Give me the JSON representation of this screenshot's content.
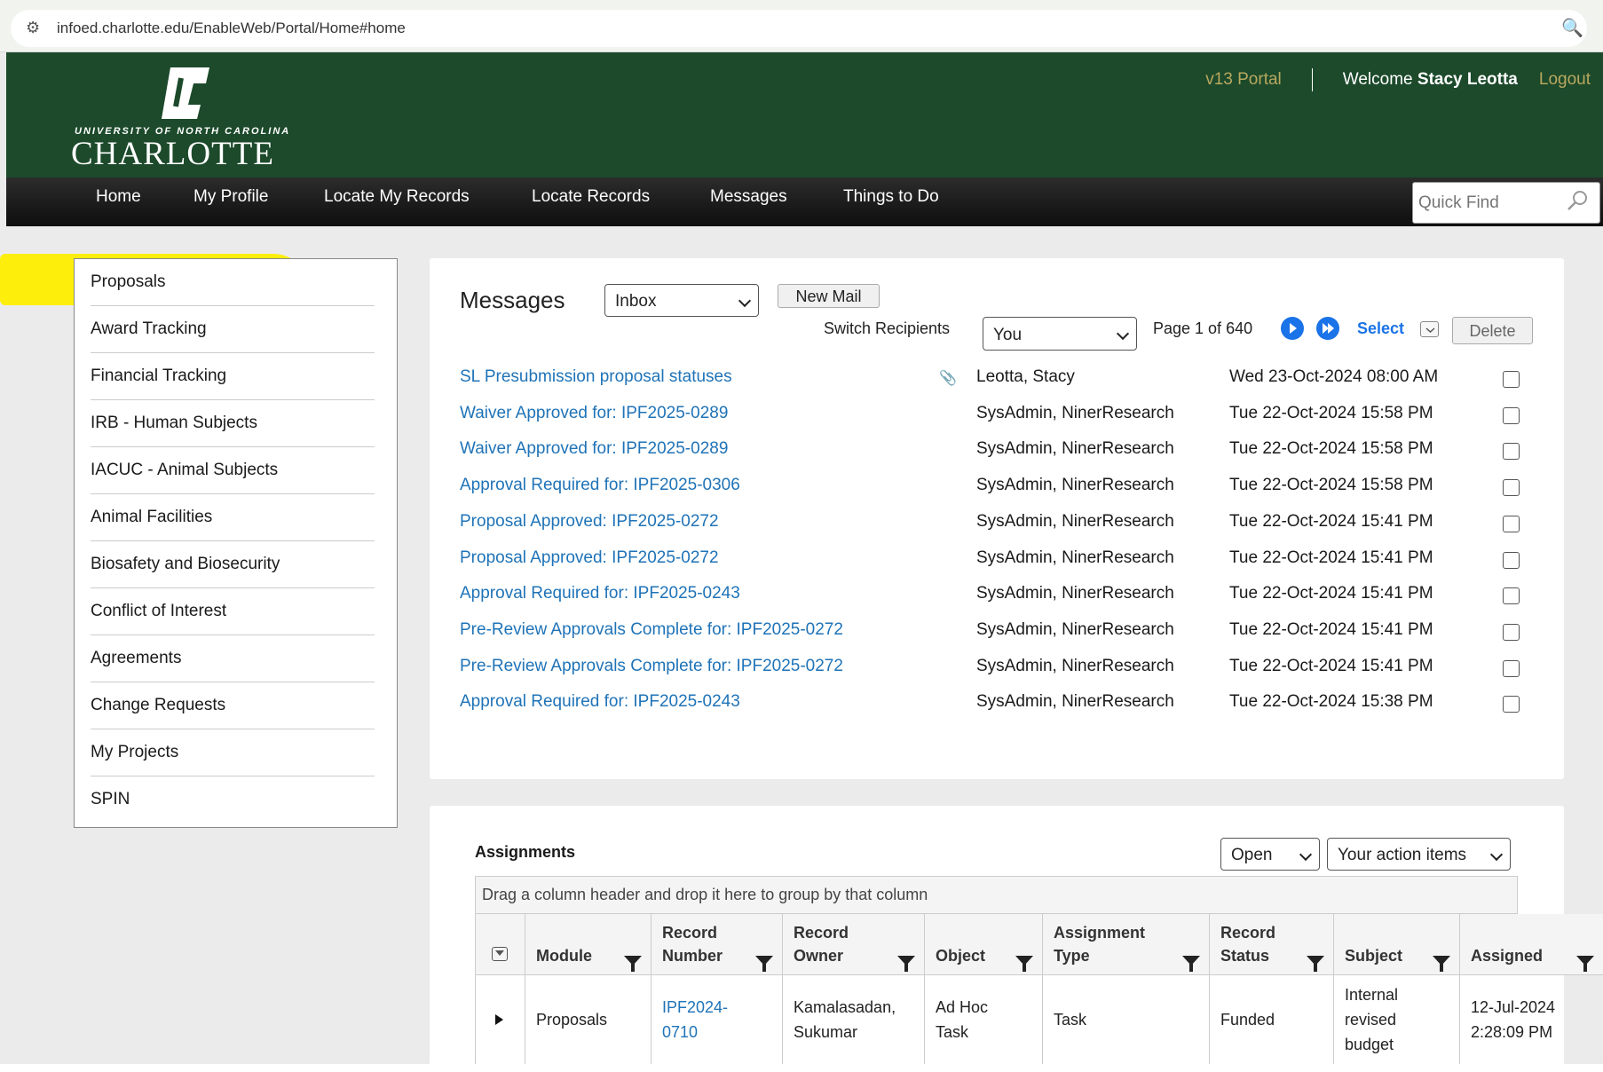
{
  "browser": {
    "url": "infoed.charlotte.edu/EnableWeb/Portal/Home#home"
  },
  "header": {
    "logo_univ": "UNIVERSITY OF NORTH CAROLINA",
    "logo_name": "CHARLOTTE",
    "portal_link": "v13 Portal",
    "welcome": "Welcome",
    "user_name": "Stacy Leotta",
    "logout": "Logout"
  },
  "nav": [
    "Home",
    "My Profile",
    "Locate My Records",
    "Locate Records",
    "Messages",
    "Things to Do"
  ],
  "quick_find": {
    "placeholder": "Quick Find"
  },
  "sidebar": [
    "Proposals",
    "Award Tracking",
    "Financial Tracking",
    "IRB - Human Subjects",
    "IACUC - Animal Subjects",
    "Animal Facilities",
    "Biosafety and Biosecurity",
    "Conflict of Interest",
    "Agreements",
    "Change Requests",
    "My Projects",
    "SPIN"
  ],
  "highlight_color": "#ffee00",
  "messages": {
    "title": "Messages",
    "folder": "Inbox",
    "new_mail": "New Mail",
    "switch_label": "Switch Recipients",
    "recipient": "You",
    "page_info": "Page 1 of 640",
    "select": "Select",
    "delete": "Delete",
    "rows": [
      {
        "subject": "SL Presubmission proposal statuses",
        "from": "Leotta, Stacy",
        "date": "Wed 23-Oct-2024 08:00 AM",
        "attachment": true
      },
      {
        "subject": "Waiver Approved for: IPF2025-0289",
        "from": "SysAdmin, NinerResearch",
        "date": "Tue 22-Oct-2024 15:58 PM"
      },
      {
        "subject": "Waiver Approved for: IPF2025-0289",
        "from": "SysAdmin, NinerResearch",
        "date": "Tue 22-Oct-2024 15:58 PM"
      },
      {
        "subject": "Approval Required for: IPF2025-0306",
        "from": "SysAdmin, NinerResearch",
        "date": "Tue 22-Oct-2024 15:58 PM"
      },
      {
        "subject": "Proposal Approved: IPF2025-0272",
        "from": "SysAdmin, NinerResearch",
        "date": "Tue 22-Oct-2024 15:41 PM"
      },
      {
        "subject": "Proposal Approved: IPF2025-0272",
        "from": "SysAdmin, NinerResearch",
        "date": "Tue 22-Oct-2024 15:41 PM"
      },
      {
        "subject": "Approval Required for: IPF2025-0243",
        "from": "SysAdmin, NinerResearch",
        "date": "Tue 22-Oct-2024 15:41 PM"
      },
      {
        "subject": "Pre-Review Approvals Complete for: IPF2025-0272",
        "from": "SysAdmin, NinerResearch",
        "date": "Tue 22-Oct-2024 15:41 PM"
      },
      {
        "subject": "Pre-Review Approvals Complete for: IPF2025-0272",
        "from": "SysAdmin, NinerResearch",
        "date": "Tue 22-Oct-2024 15:41 PM"
      },
      {
        "subject": "Approval Required for: IPF2025-0243",
        "from": "SysAdmin, NinerResearch",
        "date": "Tue 22-Oct-2024 15:38 PM"
      }
    ]
  },
  "assignments": {
    "title": "Assignments",
    "status_filter": "Open",
    "scope_filter": "Your action items",
    "drop_hint": "Drag a column header and drop it here to group by that column",
    "columns": [
      {
        "l1": "",
        "l2": "Module"
      },
      {
        "l1": "Record",
        "l2": "Number"
      },
      {
        "l1": "Record",
        "l2": "Owner"
      },
      {
        "l1": "",
        "l2": "Object"
      },
      {
        "l1": "Assignment",
        "l2": "Type"
      },
      {
        "l1": "Record",
        "l2": "Status"
      },
      {
        "l1": "",
        "l2": "Subject"
      },
      {
        "l1": "",
        "l2": "Assigned"
      }
    ],
    "row": {
      "module": "Proposals",
      "record_number": [
        "IPF2024-",
        "0710"
      ],
      "record_owner": [
        "Kamalasadan,",
        "Sukumar"
      ],
      "object": [
        "Ad Hoc",
        "Task"
      ],
      "assignment_type": "Task",
      "record_status": "Funded",
      "subject": [
        "Internal",
        "revised",
        "budget"
      ],
      "assigned": [
        "12-Jul-2024",
        "2:28:09 PM"
      ]
    }
  }
}
